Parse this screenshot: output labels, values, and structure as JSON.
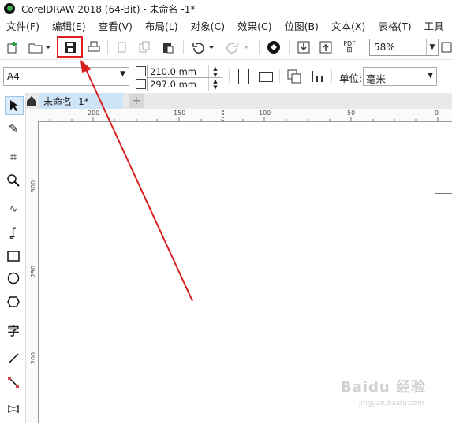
{
  "window": {
    "title": "CorelDRAW 2018 (64-Bit) - 未命名 -1*"
  },
  "menu": [
    "文件(F)",
    "编辑(E)",
    "查看(V)",
    "布局(L)",
    "对象(C)",
    "效果(C)",
    "位图(B)",
    "文本(X)",
    "表格(T)",
    "工具"
  ],
  "toolbar": {
    "zoom_value": "58%",
    "pdf_label": "PDF",
    "icons": [
      "new-document-icon",
      "open-folder-icon",
      "save-icon",
      "print-icon",
      "cut-icon",
      "copy-icon",
      "paste-icon",
      "undo-icon",
      "redo-icon",
      "corel-connect-icon",
      "import-icon",
      "export-icon",
      "publish-pdf-icon"
    ]
  },
  "property_bar": {
    "page_size": "A4",
    "width": "210.0 mm",
    "height": "297.0 mm",
    "units_label": "单位:",
    "units_value": "毫米"
  },
  "tabs": {
    "document": "未命名 -1*",
    "add": "+"
  },
  "rulers": {
    "horizontal": [
      "200",
      "150",
      "100",
      "50",
      "0"
    ],
    "vertical": [
      "300",
      "250",
      "200"
    ]
  },
  "watermark": {
    "text": "Baidu 经验",
    "sub": "jingyan.baidu.com"
  },
  "colors": {
    "highlight": "#e02020",
    "arrow": "#d62020",
    "tab_active": "#cfe3f7"
  }
}
